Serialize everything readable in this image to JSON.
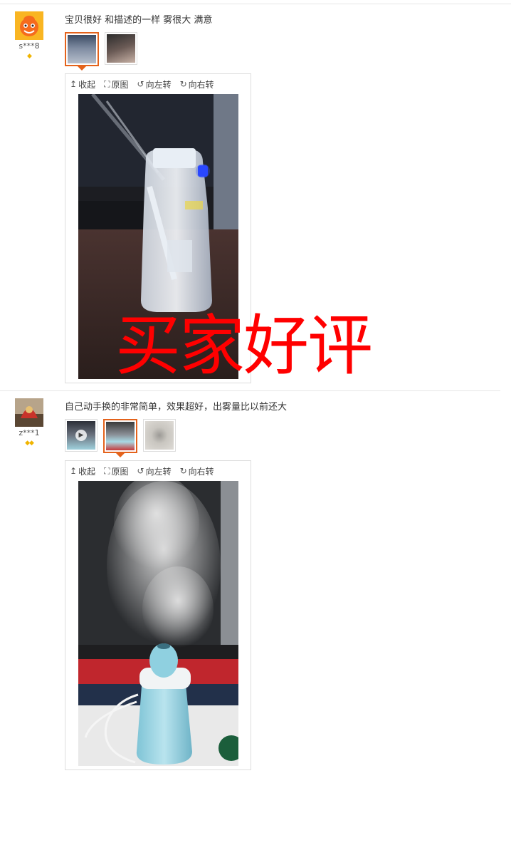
{
  "toolbar": {
    "collapse": "收起",
    "original": "原图",
    "rotate_left": "向左转",
    "rotate_right": "向右转"
  },
  "reviews": [
    {
      "username": "s***8",
      "badge_icons": "diamond",
      "comment": "宝贝很好 和描述的一样 雾很大 满意",
      "thumbnail_count": 2,
      "active_thumbnail": 1
    },
    {
      "username": "z***1",
      "badge_icons": "diamond diamond",
      "comment": "自己动手换的非常简单，效果超好，出雾量比以前还大",
      "thumbnail_count": 3,
      "active_thumbnail": 2
    }
  ],
  "watermark": "买家好评",
  "colors": {
    "accent": "#e4621b",
    "watermark": "#ff0000",
    "badge": "#f0b400",
    "border": "#dddddd"
  }
}
